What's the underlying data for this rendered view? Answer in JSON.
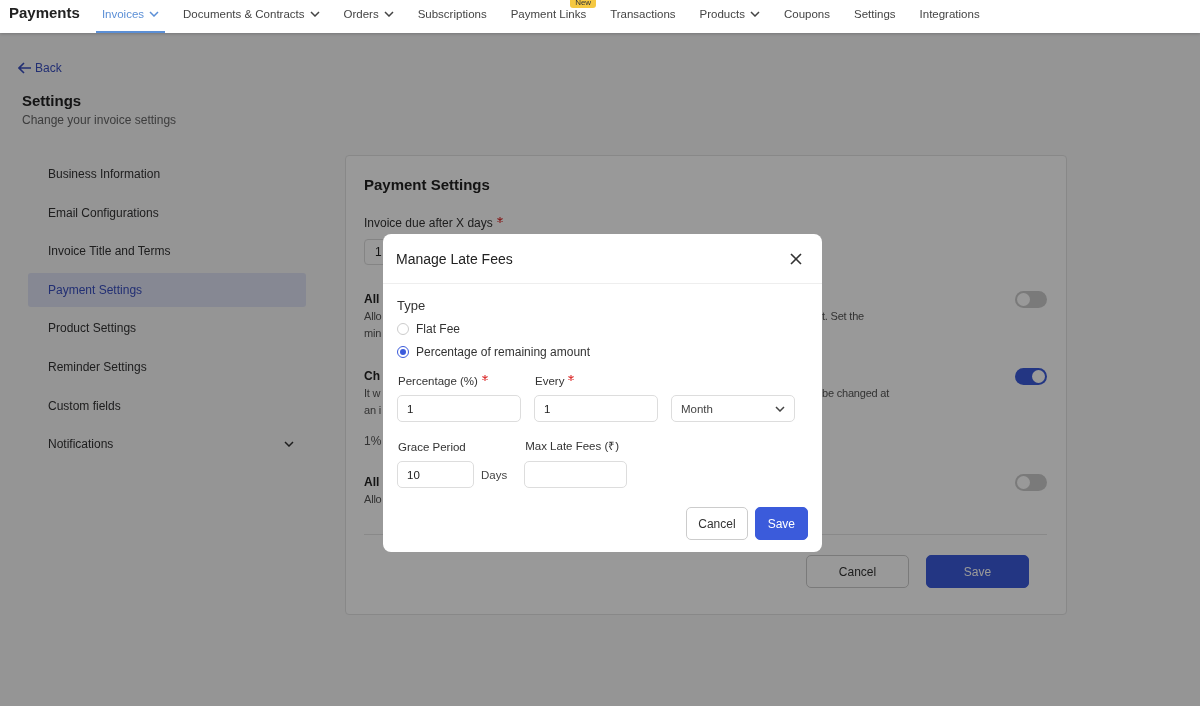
{
  "nav": {
    "brand": "Payments",
    "items": [
      {
        "label": "Invoices",
        "selected": true,
        "dropdown": true
      },
      {
        "label": "Documents & Contracts",
        "selected": false,
        "dropdown": true
      },
      {
        "label": "Orders",
        "selected": false,
        "dropdown": true
      },
      {
        "label": "Subscriptions",
        "selected": false,
        "dropdown": false
      },
      {
        "label": "Payment Links",
        "selected": false,
        "dropdown": false,
        "badge": "New"
      },
      {
        "label": "Transactions",
        "selected": false,
        "dropdown": false
      },
      {
        "label": "Products",
        "selected": false,
        "dropdown": true
      },
      {
        "label": "Coupons",
        "selected": false,
        "dropdown": false
      },
      {
        "label": "Settings",
        "selected": false,
        "dropdown": false
      },
      {
        "label": "Integrations",
        "selected": false,
        "dropdown": false
      }
    ]
  },
  "back": "Back",
  "page": {
    "title": "Settings",
    "subtitle": "Change your invoice settings"
  },
  "sidebar": {
    "items": [
      {
        "label": "Business Information",
        "selected": false,
        "expandable": false
      },
      {
        "label": "Email Configurations",
        "selected": false,
        "expandable": false
      },
      {
        "label": "Invoice Title and Terms",
        "selected": false,
        "expandable": false
      },
      {
        "label": "Payment Settings",
        "selected": true,
        "expandable": false
      },
      {
        "label": "Product Settings",
        "selected": false,
        "expandable": false
      },
      {
        "label": "Reminder Settings",
        "selected": false,
        "expandable": false
      },
      {
        "label": "Custom fields",
        "selected": false,
        "expandable": false
      },
      {
        "label": "Notifications",
        "selected": false,
        "expandable": true
      }
    ]
  },
  "card": {
    "title": "Payment Settings",
    "due_label": "Invoice due after X days",
    "due_required": true,
    "due_value": "1",
    "sections": [
      {
        "title": "All",
        "on": false,
        "lines": [
          {
            "left": "Allo",
            "right": "t. Set the"
          },
          {
            "left": "min"
          }
        ]
      },
      {
        "title": "Ch",
        "on": true,
        "lines": [
          {
            "left": "It w",
            "right": "be changed at"
          },
          {
            "left": "an i"
          }
        ],
        "note": "1%"
      },
      {
        "title": "All",
        "on": false,
        "lines": [
          {
            "left": "Allo"
          }
        ]
      }
    ],
    "buttons": [
      {
        "label": "Cancel",
        "kind": "secondary"
      },
      {
        "label": "Save",
        "kind": "primary"
      }
    ]
  },
  "modal": {
    "title": "Manage Late Fees",
    "type_label": "Type",
    "types": [
      {
        "label": "Flat Fee",
        "selected": false
      },
      {
        "label": "Percentage of remaining amount",
        "selected": true
      }
    ],
    "percentage": {
      "label": "Percentage (%)",
      "required": true,
      "value": "1"
    },
    "every": {
      "label": "Every",
      "required": true,
      "value": "1"
    },
    "unit": {
      "value": "Month"
    },
    "grace": {
      "label": "Grace Period",
      "value": "10",
      "suffix": "Days"
    },
    "max_fees": {
      "label": "Max Late Fees (₹)"
    },
    "buttons": [
      {
        "label": "Cancel",
        "kind": "secondary"
      },
      {
        "label": "Save",
        "kind": "primary"
      }
    ]
  }
}
